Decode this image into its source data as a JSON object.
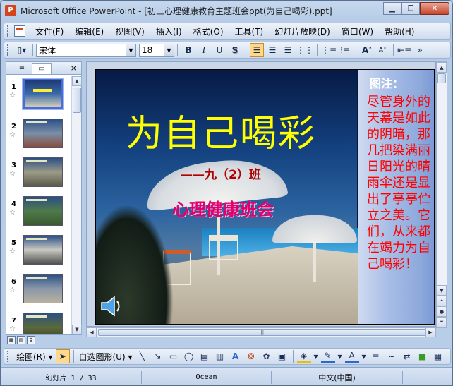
{
  "window": {
    "title": "Microsoft Office PowerPoint - [初三心理健康教育主题班会ppt(为自己喝彩).ppt]",
    "app_icon": "powerpoint-icon",
    "controls": [
      "minimize-icon",
      "restore-icon",
      "close-icon"
    ]
  },
  "menubar": {
    "items": [
      "文件(F)",
      "编辑(E)",
      "视图(V)",
      "插入(I)",
      "格式(O)",
      "工具(T)",
      "幻灯片放映(D)",
      "窗口(W)",
      "帮助(H)"
    ]
  },
  "toolbar": {
    "font": "宋体",
    "font_size": "18",
    "bold": "B",
    "italic": "I",
    "underline": "U",
    "shadow": "S",
    "increase_font": "A",
    "decrease_font": "A"
  },
  "outline_pane": {
    "tabs": [
      "outline-icon",
      "slides-icon"
    ],
    "close": "×",
    "slides": [
      {
        "num": "1",
        "star": "☆",
        "selected": true
      },
      {
        "num": "2",
        "star": "☆",
        "selected": false
      },
      {
        "num": "3",
        "star": "☆",
        "selected": false
      },
      {
        "num": "4",
        "star": "☆",
        "selected": false
      },
      {
        "num": "5",
        "star": "☆",
        "selected": false
      },
      {
        "num": "6",
        "star": "☆",
        "selected": false
      },
      {
        "num": "7",
        "star": "☆",
        "selected": false
      }
    ]
  },
  "slide": {
    "title": "为自己喝彩",
    "subtitle": "——九（2）班",
    "subtitle2": "心理健康班会",
    "note_label": "图注：",
    "note_text": "尽管身外的天幕是如此的阴暗，那几把染满丽日阳光的晴雨伞还是显出了亭亭伫立之美。它们，从来都在竭力为自己喝彩！"
  },
  "drawbar": {
    "draw": "绘图(R)",
    "autoshapes": "自选图形(U)"
  },
  "statusbar": {
    "slide": "幻灯片 1 / 33",
    "design": "Ocean",
    "language": "中文(中国)"
  },
  "colors": {
    "title": "#ffff00",
    "subtitle": "#b00000",
    "subtitle2": "#e0006e",
    "note_text": "#ff0000"
  }
}
